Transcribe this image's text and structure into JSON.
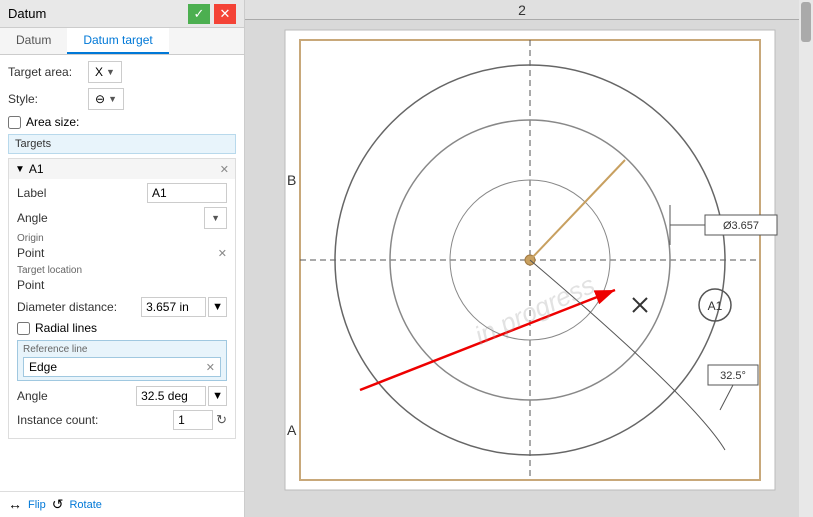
{
  "panel": {
    "title": "Datum",
    "confirm_label": "✓",
    "cancel_label": "✕"
  },
  "tabs": {
    "items": [
      {
        "id": "datum",
        "label": "Datum",
        "active": false
      },
      {
        "id": "datum-target",
        "label": "Datum target",
        "active": true
      }
    ]
  },
  "form": {
    "target_area_label": "Target area:",
    "target_area_value": "X",
    "style_label": "Style:",
    "style_value": "⊖",
    "area_size_label": "Area size:",
    "targets_header": "Targets",
    "target_a1": {
      "label": "A1",
      "label_field": "Label",
      "label_value": "A1",
      "angle_label": "Angle",
      "origin_label": "Origin",
      "origin_value": "Point",
      "target_location_label": "Target location",
      "target_location_value": "Point",
      "diameter_distance_label": "Diameter distance:",
      "diameter_distance_value": "3.657 in",
      "radial_lines_label": "Radial lines",
      "reference_line_header": "Reference line",
      "reference_line_value": "Edge",
      "angle_label2": "Angle",
      "angle_value": "32.5 deg",
      "instance_count_label": "Instance count:",
      "instance_count_value": "1"
    }
  },
  "bottom_actions": {
    "flip_label": "Flip",
    "rotate_label": "Rotate"
  },
  "canvas": {
    "grid_label_top": "2",
    "grid_label_b": "B",
    "grid_label_a": "A",
    "diameter_annotation": "Ø3.657",
    "angle_annotation": "32.5°",
    "target_label": "A1",
    "watermark": "in progress"
  }
}
